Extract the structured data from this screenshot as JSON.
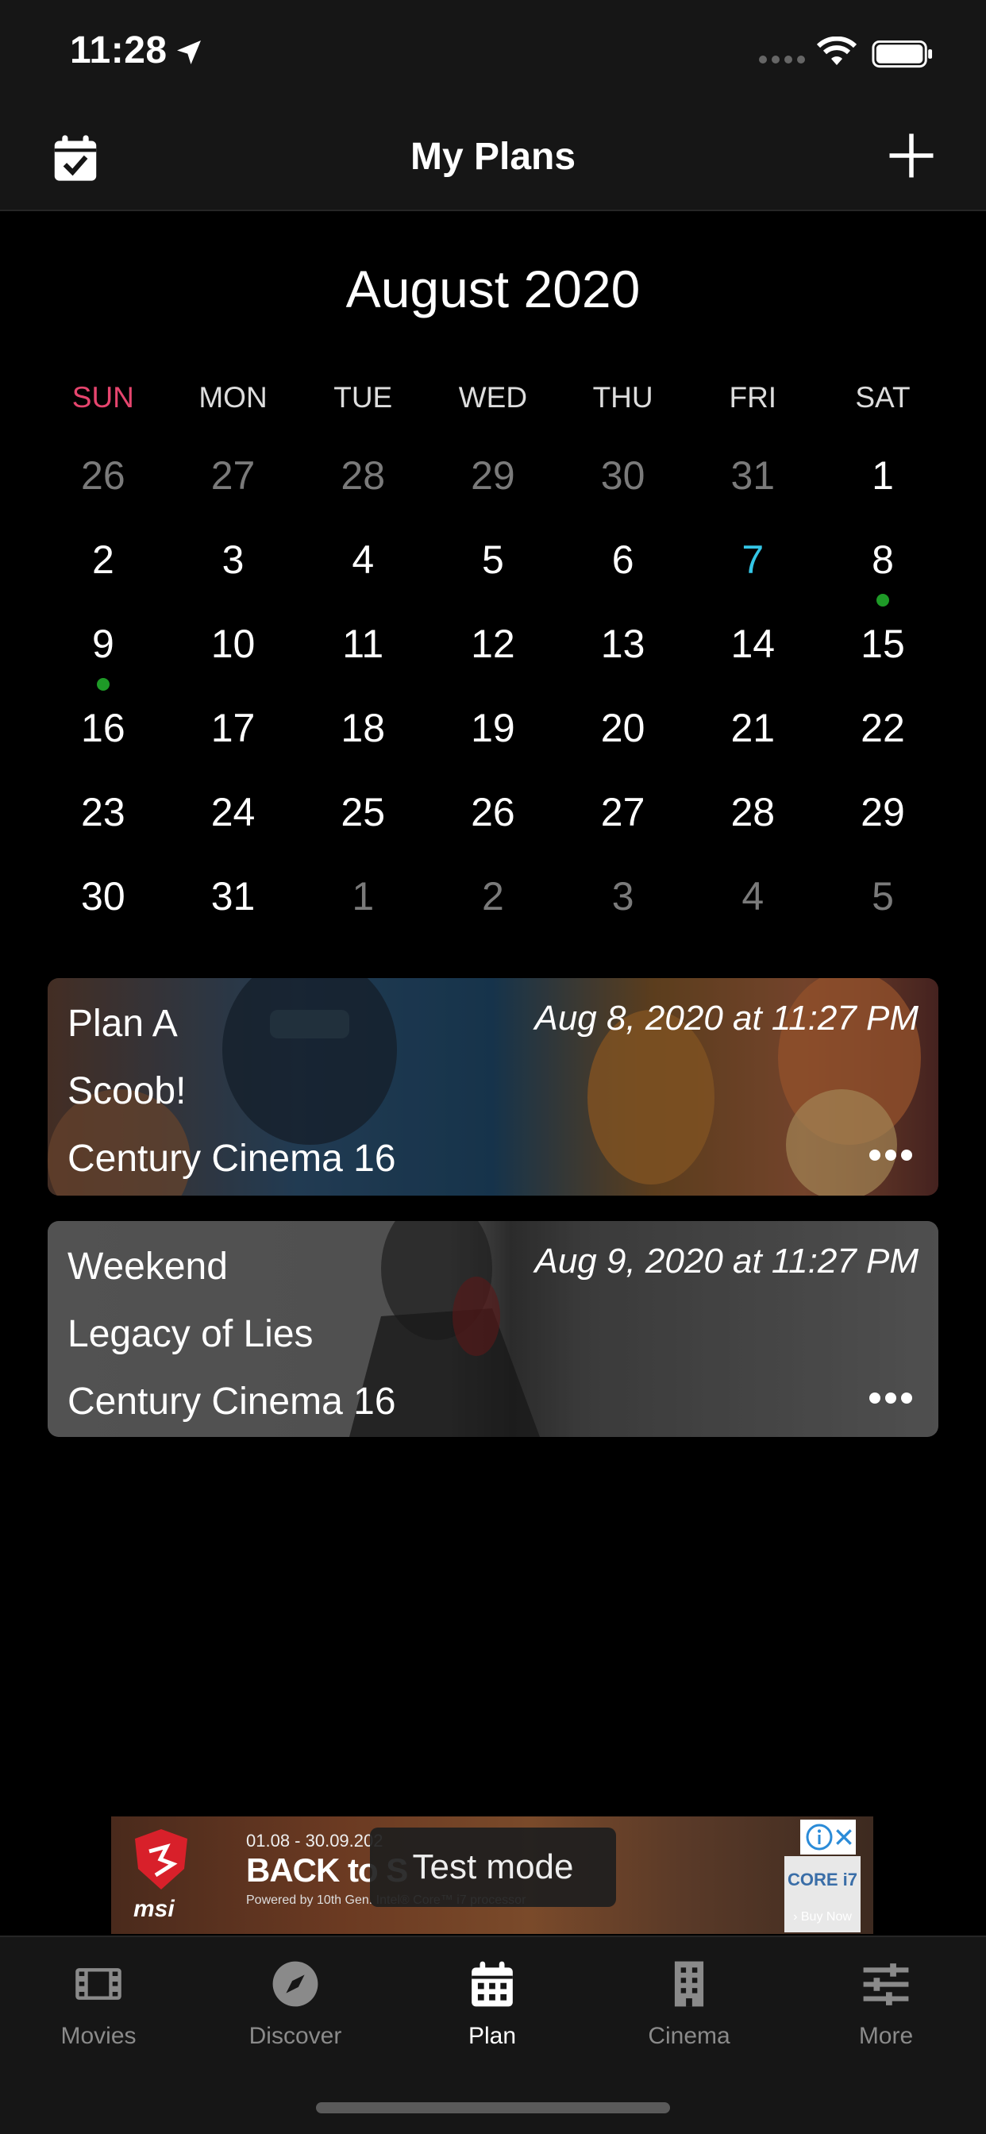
{
  "status_bar": {
    "time": "11:28"
  },
  "nav": {
    "title": "My Plans",
    "left_icon": "calendar-check-icon",
    "right_icon": "plus-icon"
  },
  "calendar": {
    "month_title": "August 2020",
    "weekdays": [
      "SUN",
      "MON",
      "TUE",
      "WED",
      "THU",
      "FRI",
      "SAT"
    ],
    "today": "7",
    "weeks": [
      [
        "26",
        "27",
        "28",
        "29",
        "30",
        "31",
        "1"
      ],
      [
        "2",
        "3",
        "4",
        "5",
        "6",
        "7",
        "8"
      ],
      [
        "9",
        "10",
        "11",
        "12",
        "13",
        "14",
        "15"
      ],
      [
        "16",
        "17",
        "18",
        "19",
        "20",
        "21",
        "22"
      ],
      [
        "23",
        "24",
        "25",
        "26",
        "27",
        "28",
        "29"
      ],
      [
        "30",
        "31",
        "1",
        "2",
        "3",
        "4",
        "5"
      ]
    ],
    "days_with_plans": [
      "8",
      "9"
    ]
  },
  "plans": [
    {
      "name": "Plan A",
      "movie": "Scoob!",
      "cinema": "Century Cinema 16",
      "datetime": "Aug 8, 2020 at 11:27 PM"
    },
    {
      "name": "Weekend",
      "movie": "Legacy of Lies",
      "cinema": "Century Cinema 16",
      "datetime": "Aug 9, 2020 at 11:27 PM"
    }
  ],
  "ad": {
    "label": "Test mode",
    "brand": "msi",
    "dates": "01.08 - 30.09.202",
    "headline": "BACK to S",
    "powered": "Powered by 10th Gen. Intel® Core™ i7 processor",
    "badge": "CORE i7",
    "cta": "› Buy Now"
  },
  "tabs": [
    {
      "label": "Movies",
      "icon": "film-icon",
      "active": false
    },
    {
      "label": "Discover",
      "icon": "compass-icon",
      "active": false
    },
    {
      "label": "Plan",
      "icon": "calendar-icon",
      "active": true
    },
    {
      "label": "Cinema",
      "icon": "building-icon",
      "active": false
    },
    {
      "label": "More",
      "icon": "sliders-icon",
      "active": false
    }
  ],
  "colors": {
    "sunday": "#e6456e",
    "today": "#34c6e6",
    "plan_dot": "#1e9a27"
  }
}
